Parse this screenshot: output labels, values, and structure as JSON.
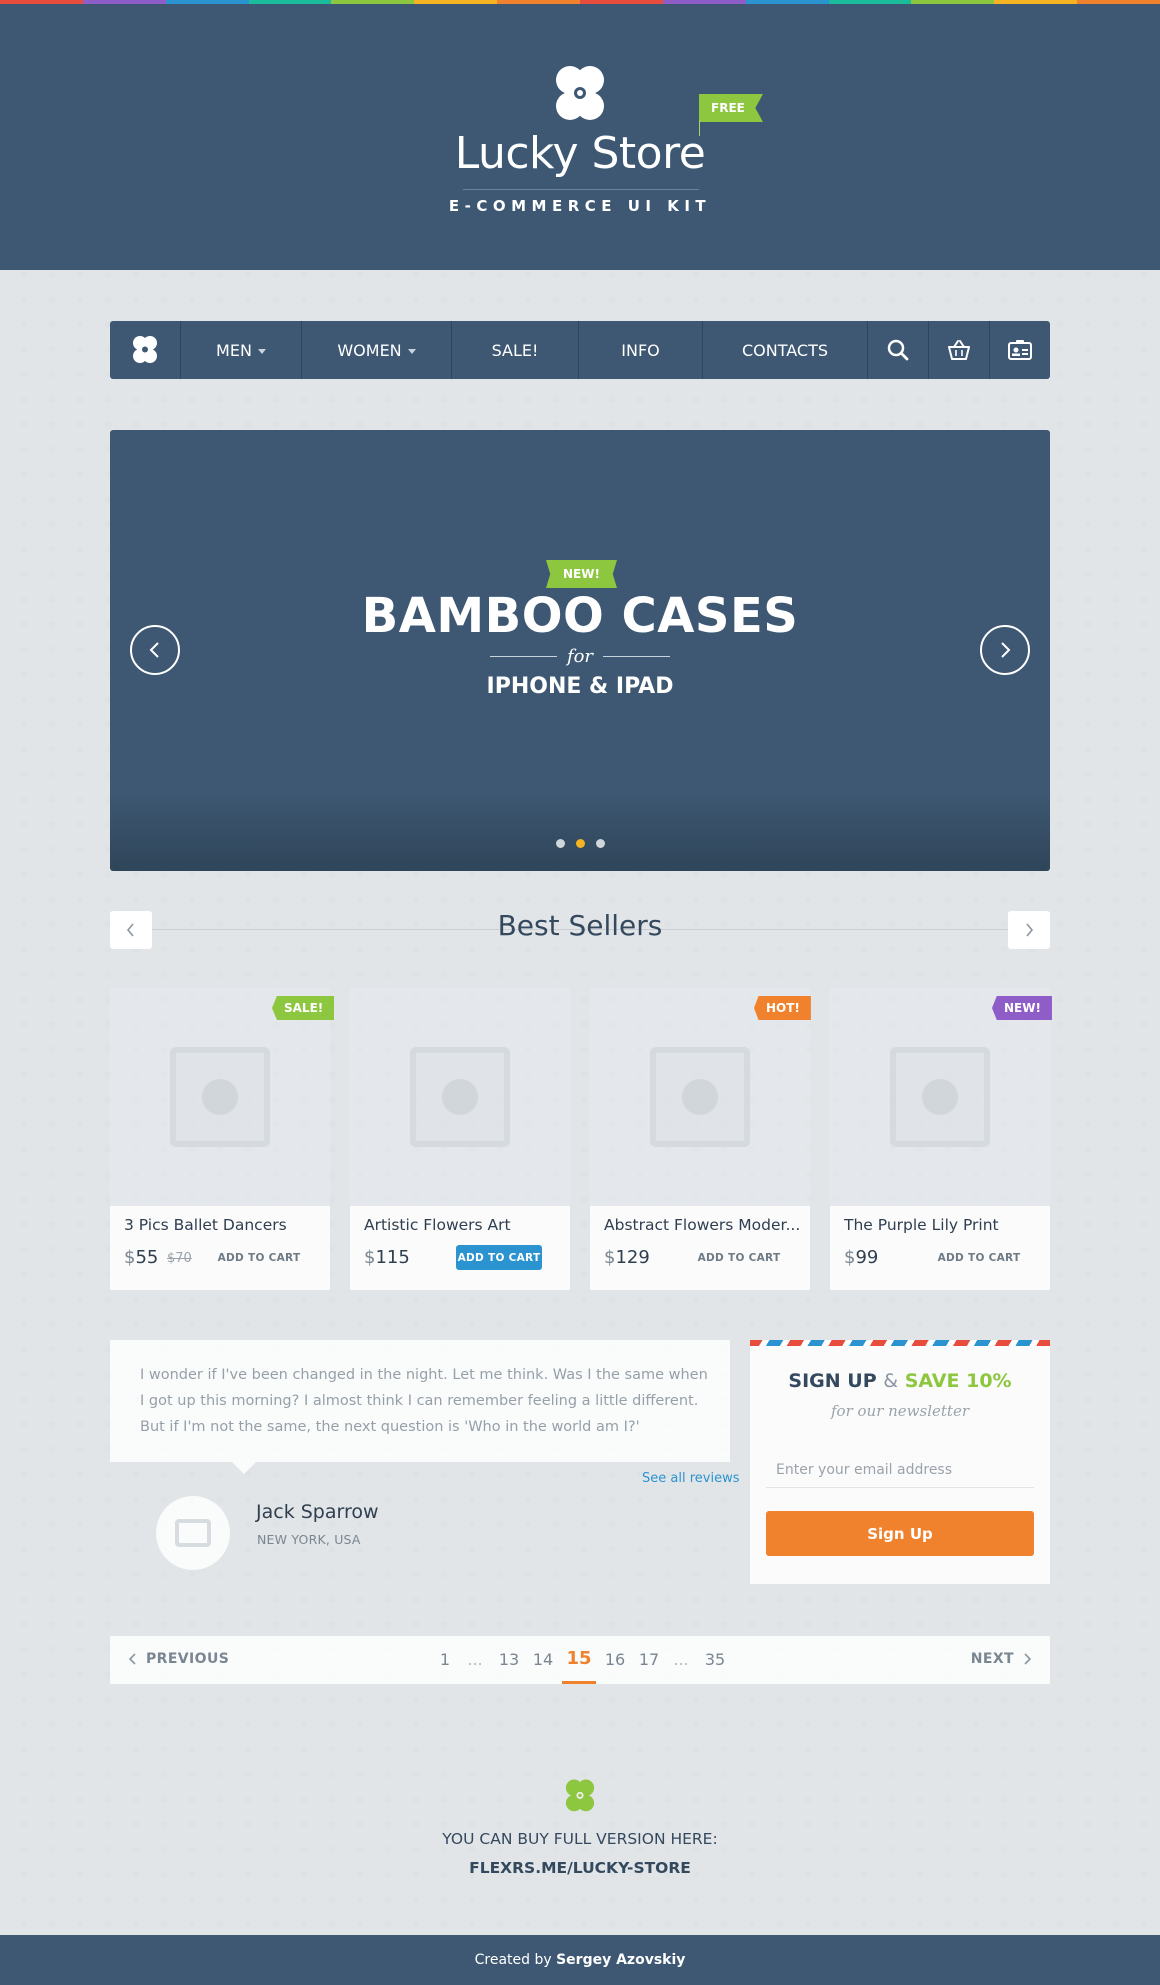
{
  "brand": {
    "name": "Lucky Store",
    "subtitle": "E-COMMERCE UI KIT",
    "free_label": "FREE"
  },
  "colors": {
    "navy": "#3e5873",
    "green": "#8dc63f",
    "orange": "#f0822d",
    "blue": "#2a93d0",
    "purple": "#8e5dc7",
    "yellow": "#f5b221"
  },
  "nav": {
    "items": [
      {
        "label": "MEN",
        "has_dropdown": true
      },
      {
        "label": "WOMEN",
        "has_dropdown": true
      },
      {
        "label": "SALE!",
        "has_dropdown": false
      },
      {
        "label": "INFO",
        "has_dropdown": false
      },
      {
        "label": "CONTACTS",
        "has_dropdown": false
      }
    ],
    "icons": [
      "search-icon",
      "basket-icon",
      "account-card-icon"
    ]
  },
  "slider": {
    "badge": "NEW!",
    "title": "BAMBOO CASES",
    "connector": "for",
    "subtitle": "IPHONE & IPAD",
    "slide_count": 3,
    "active_slide": 2
  },
  "best_sellers": {
    "title": "Best Sellers",
    "products": [
      {
        "name": "3 Pics Ballet Dancers",
        "currency": "$",
        "price": "55",
        "old_price": "$70",
        "badge": "SALE!",
        "cart_label": "ADD TO CART"
      },
      {
        "name": "Artistic Flowers Art",
        "currency": "$",
        "price": "115",
        "old_price": "",
        "badge": "",
        "cart_label": "ADD TO CART"
      },
      {
        "name": "Abstract Flowers Moder...",
        "currency": "$",
        "price": "129",
        "old_price": "",
        "badge": "HOT!",
        "cart_label": "ADD TO CART"
      },
      {
        "name": "The Purple Lily Print",
        "currency": "$",
        "price": "99",
        "old_price": "",
        "badge": "NEW!",
        "cart_label": "ADD TO CART"
      }
    ]
  },
  "testimonial": {
    "quote": "I wonder if I've been changed in the night. Let me think. Was I the same when I got up this morning? I almost think I can remember feeling a little different. But if I'm not the same, the next question is 'Who in the world am I?'",
    "see_all": "See all reviews",
    "author": "Jack Sparrow",
    "location": "NEW YORK, USA"
  },
  "newsletter": {
    "title_a": "SIGN UP",
    "title_amp": "&",
    "title_b": "SAVE 10%",
    "subtitle": "for our newsletter",
    "email_placeholder": "Enter your email address",
    "button": "Sign Up"
  },
  "pagination": {
    "prev": "PREVIOUS",
    "next": "NEXT",
    "pages": [
      "1",
      "...",
      "13",
      "14",
      "15",
      "16",
      "17",
      "...",
      "35"
    ],
    "current": "15"
  },
  "promo": {
    "text": "YOU CAN BUY FULL VERSION HERE:",
    "link": "FLEXRS.ME/LUCKY-STORE"
  },
  "footer": {
    "prefix": "Created by",
    "author": "Sergey Azovskiy"
  }
}
